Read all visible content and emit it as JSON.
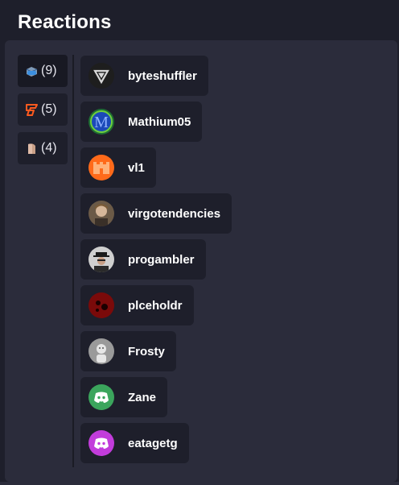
{
  "dialog": {
    "title": "Reactions"
  },
  "tabs": [
    {
      "count": "(9)",
      "emoji_icon": "cloud-cube-emoji-icon",
      "color": "#3b8fe0",
      "selected": true
    },
    {
      "count": "(5)",
      "emoji_icon": "orange-logo-emoji-icon",
      "color": "#ff5a1f",
      "selected": false
    },
    {
      "count": "(4)",
      "emoji_icon": "potato-emoji-icon",
      "color": "#c9a088",
      "selected": false
    }
  ],
  "users": [
    {
      "name": "byteshuffler",
      "avatar_icon": "triangle-logo-avatar",
      "avatar_color": "#1e1e1e"
    },
    {
      "name": "Mathium05",
      "avatar_icon": "letter-m-avatar",
      "avatar_color": "#1f6f34"
    },
    {
      "name": "vl1",
      "avatar_icon": "orange-castle-avatar",
      "avatar_color": "#ff6a1a"
    },
    {
      "name": "virgotendencies",
      "avatar_icon": "photo-person-avatar",
      "avatar_color": "#6b5a47"
    },
    {
      "name": "progambler",
      "avatar_icon": "photo-hat-person-avatar",
      "avatar_color": "#8a8a8a"
    },
    {
      "name": "plceholdr",
      "avatar_icon": "red-dark-avatar",
      "avatar_color": "#7a0a0a"
    },
    {
      "name": "Frosty",
      "avatar_icon": "grey-figure-avatar",
      "avatar_color": "#9a9a9a"
    },
    {
      "name": "Zane",
      "avatar_icon": "discord-default-avatar",
      "avatar_color": "#3ba55c"
    },
    {
      "name": "eatagetg",
      "avatar_icon": "discord-default-avatar",
      "avatar_color": "#c23cdb"
    }
  ]
}
